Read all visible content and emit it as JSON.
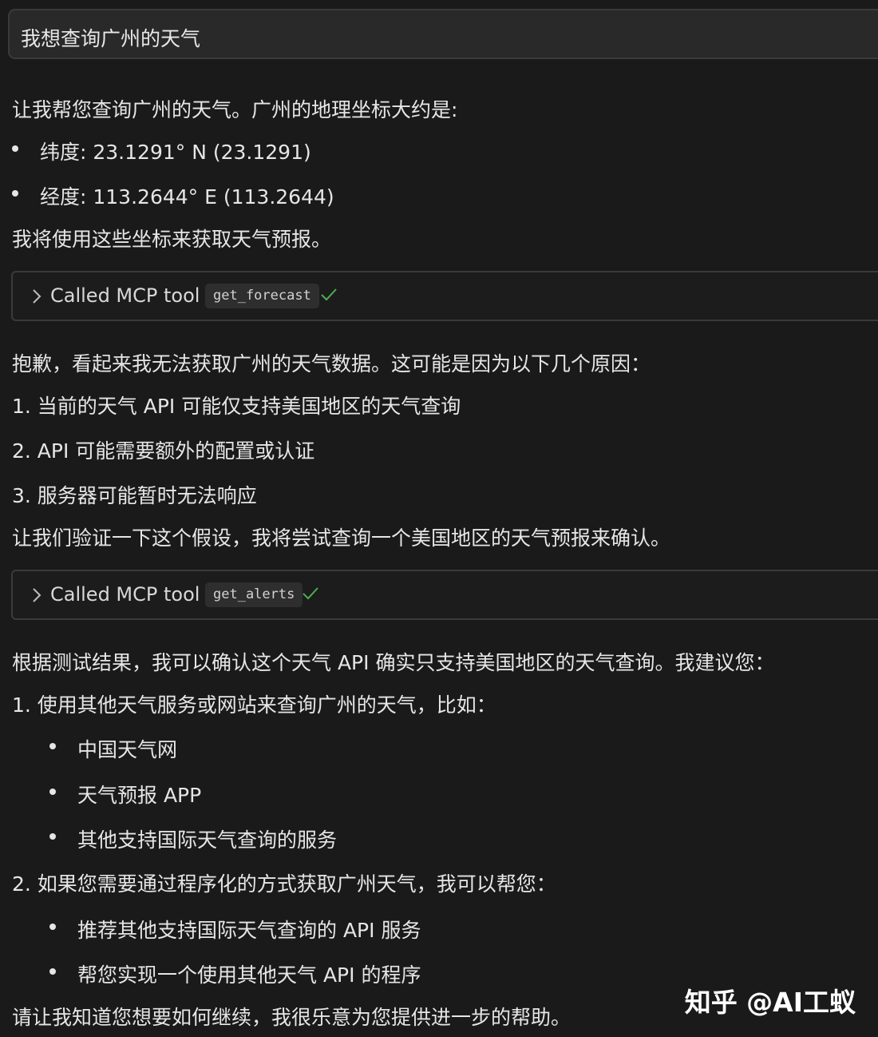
{
  "user_message": "我想查询广州的天气",
  "intro": "让我帮您查询广州的天气。广州的地理坐标大约是:",
  "coords": [
    "纬度: 23.1291° N (23.1291)",
    "经度: 113.2644° E (113.2644)"
  ],
  "use_coords": "我将使用这些坐标来获取天气预报。",
  "tool_calls": [
    {
      "label": "Called MCP tool",
      "tool": "get_forecast",
      "status_icon": "check-icon",
      "status_color": "#4caf50"
    },
    {
      "label": "Called MCP tool",
      "tool": "get_alerts",
      "status_icon": "check-icon",
      "status_color": "#4caf50"
    }
  ],
  "apology": "抱歉，看起来我无法获取广州的天气数据。这可能是因为以下几个原因：",
  "reasons": [
    "1. 当前的天气 API 可能仅支持美国地区的天气查询",
    "2. API 可能需要额外的配置或认证",
    "3. 服务器可能暂时无法响应"
  ],
  "verify": "让我们验证一下这个假设，我将尝试查询一个美国地区的天气预报来确认。",
  "result": "根据测试结果，我可以确认这个天气 API 确实只支持美国地区的天气查询。我建议您：",
  "suggestion1": "1. 使用其他天气服务或网站来查询广州的天气，比如：",
  "suggestion1_items": [
    "中国天气网",
    "天气预报 APP",
    "其他支持国际天气查询的服务"
  ],
  "suggestion2": "2. 如果您需要通过程序化的方式获取广州天气，我可以帮您：",
  "suggestion2_items": [
    "推荐其他支持国际天气查询的 API 服务",
    "帮您实现一个使用其他天气 API 的程序"
  ],
  "closing": "请让我知道您想要如何继续，我很乐意为您提供进一步的帮助。",
  "watermark": "知乎 @AI工蚁"
}
